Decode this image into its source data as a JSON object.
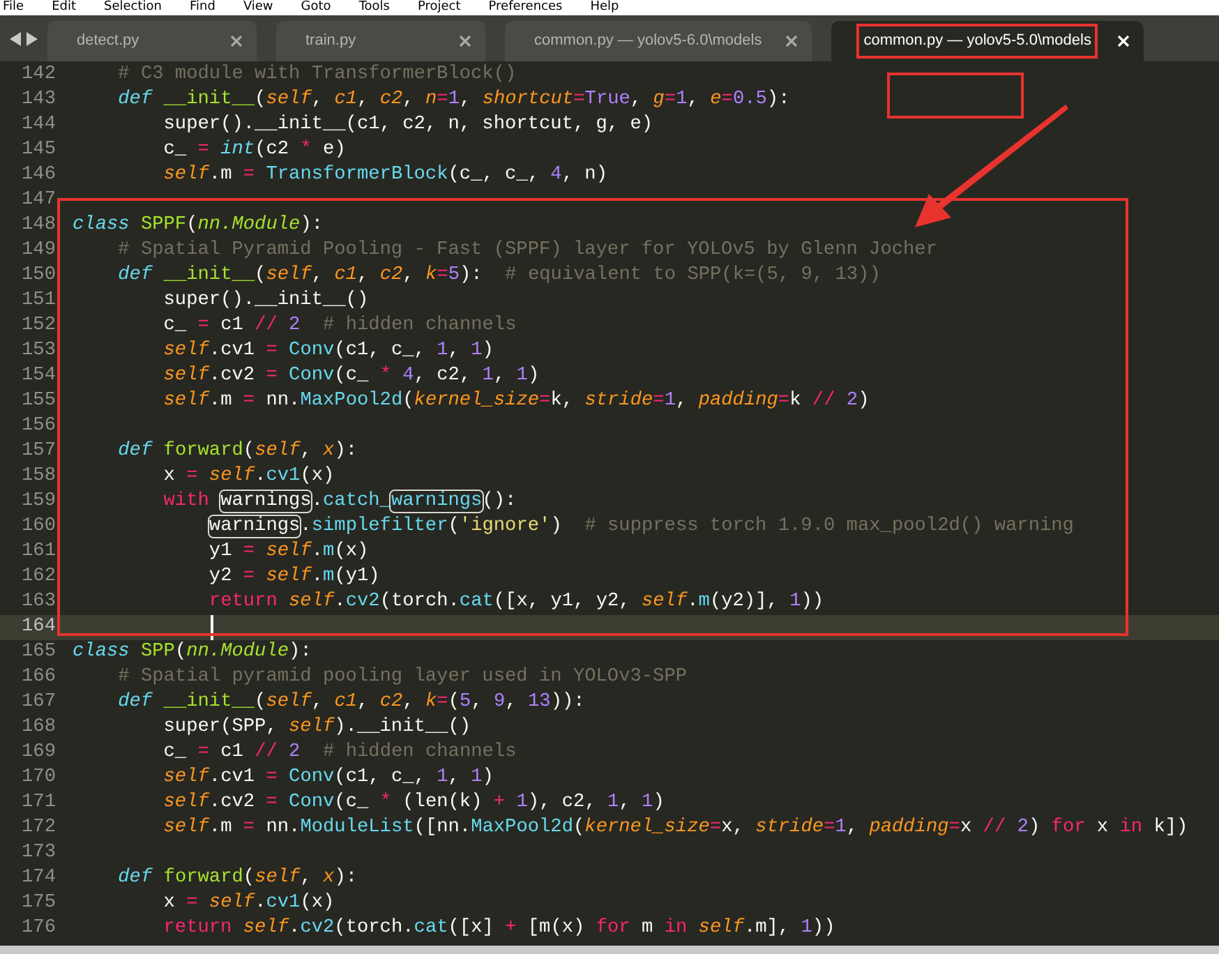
{
  "menu": [
    "File",
    "Edit",
    "Selection",
    "Find",
    "View",
    "Goto",
    "Tools",
    "Project",
    "Preferences",
    "Help"
  ],
  "tabs": [
    {
      "label": "detect.py",
      "selected": false,
      "marked": false
    },
    {
      "label": "train.py",
      "selected": false,
      "marked": false
    },
    {
      "label": "common.py — yolov5-6.0\\models",
      "selected": false,
      "marked": false
    },
    {
      "label": "common.py — yolov5-5.0\\models",
      "selected": true,
      "marked": true
    }
  ],
  "lines": [
    {
      "number": "142",
      "current": false,
      "tokens": [
        {
          "kind": "comment",
          "text": "    # C3 module with TransformerBlock()"
        }
      ]
    },
    {
      "number": "143",
      "current": false,
      "tokens": [
        {
          "kind": "storage",
          "text": "    def "
        },
        {
          "kind": "name",
          "text": "__init__"
        },
        {
          "kind": "plain",
          "text": "("
        },
        {
          "kind": "param",
          "text": "self"
        },
        {
          "kind": "plain",
          "text": ", "
        },
        {
          "kind": "param",
          "text": "c1"
        },
        {
          "kind": "plain",
          "text": ", "
        },
        {
          "kind": "param",
          "text": "c2"
        },
        {
          "kind": "plain",
          "text": ", "
        },
        {
          "kind": "param",
          "text": "n"
        },
        {
          "kind": "op",
          "text": "="
        },
        {
          "kind": "number",
          "text": "1"
        },
        {
          "kind": "plain",
          "text": ", "
        },
        {
          "kind": "param",
          "text": "shortcut"
        },
        {
          "kind": "op",
          "text": "="
        },
        {
          "kind": "number",
          "text": "True"
        },
        {
          "kind": "plain",
          "text": ", "
        },
        {
          "kind": "param",
          "text": "g"
        },
        {
          "kind": "op",
          "text": "="
        },
        {
          "kind": "number",
          "text": "1"
        },
        {
          "kind": "plain",
          "text": ", "
        },
        {
          "kind": "param",
          "text": "e"
        },
        {
          "kind": "op",
          "text": "="
        },
        {
          "kind": "number",
          "text": "0.5"
        },
        {
          "kind": "plain",
          "text": "):"
        }
      ]
    },
    {
      "number": "144",
      "current": false,
      "tokens": [
        {
          "kind": "plain",
          "text": "        super().__init__(c1, c2, n, shortcut, g, e)"
        }
      ]
    },
    {
      "number": "145",
      "current": false,
      "tokens": [
        {
          "kind": "plain",
          "text": "        c_ "
        },
        {
          "kind": "op",
          "text": "= "
        },
        {
          "kind": "storage",
          "text": "int"
        },
        {
          "kind": "plain",
          "text": "(c2 "
        },
        {
          "kind": "op",
          "text": "* "
        },
        {
          "kind": "plain",
          "text": "e)"
        }
      ]
    },
    {
      "number": "146",
      "current": false,
      "tokens": [
        {
          "kind": "self",
          "text": "        self"
        },
        {
          "kind": "plain",
          "text": ".m "
        },
        {
          "kind": "op",
          "text": "= "
        },
        {
          "kind": "support",
          "text": "TransformerBlock"
        },
        {
          "kind": "plain",
          "text": "(c_, c_, "
        },
        {
          "kind": "number",
          "text": "4"
        },
        {
          "kind": "plain",
          "text": ", n)"
        }
      ]
    },
    {
      "number": "147",
      "current": false
    },
    {
      "number": "148",
      "current": false,
      "tokens": [
        {
          "kind": "storage",
          "text": "class "
        },
        {
          "kind": "name",
          "text": "SPPF"
        },
        {
          "kind": "plain",
          "text": "("
        },
        {
          "kind": "inherit",
          "text": "nn.Module"
        },
        {
          "kind": "plain",
          "text": "):"
        }
      ]
    },
    {
      "number": "149",
      "current": false,
      "tokens": [
        {
          "kind": "comment",
          "text": "    # Spatial Pyramid Pooling - Fast (SPPF) layer for YOLOv5 by Glenn Jocher"
        }
      ]
    },
    {
      "number": "150",
      "current": false,
      "tokens": [
        {
          "kind": "storage",
          "text": "    def "
        },
        {
          "kind": "name",
          "text": "__init__"
        },
        {
          "kind": "plain",
          "text": "("
        },
        {
          "kind": "param",
          "text": "self"
        },
        {
          "kind": "plain",
          "text": ", "
        },
        {
          "kind": "param",
          "text": "c1"
        },
        {
          "kind": "plain",
          "text": ", "
        },
        {
          "kind": "param",
          "text": "c2"
        },
        {
          "kind": "plain",
          "text": ", "
        },
        {
          "kind": "param",
          "text": "k"
        },
        {
          "kind": "op",
          "text": "="
        },
        {
          "kind": "number",
          "text": "5"
        },
        {
          "kind": "plain",
          "text": "):"
        },
        {
          "kind": "comment",
          "text": "  # equivalent to SPP(k=(5, 9, 13))"
        }
      ]
    },
    {
      "number": "151",
      "current": false,
      "tokens": [
        {
          "kind": "plain",
          "text": "        super().__init__()"
        }
      ]
    },
    {
      "number": "152",
      "current": false,
      "tokens": [
        {
          "kind": "plain",
          "text": "        c_ "
        },
        {
          "kind": "op",
          "text": "= "
        },
        {
          "kind": "plain",
          "text": "c1 "
        },
        {
          "kind": "op",
          "text": "// "
        },
        {
          "kind": "number",
          "text": "2"
        },
        {
          "kind": "comment",
          "text": "  # hidden channels"
        }
      ]
    },
    {
      "number": "153",
      "current": false,
      "tokens": [
        {
          "kind": "self",
          "text": "        self"
        },
        {
          "kind": "plain",
          "text": ".cv1 "
        },
        {
          "kind": "op",
          "text": "= "
        },
        {
          "kind": "support",
          "text": "Conv"
        },
        {
          "kind": "plain",
          "text": "(c1, c_, "
        },
        {
          "kind": "number",
          "text": "1"
        },
        {
          "kind": "plain",
          "text": ", "
        },
        {
          "kind": "number",
          "text": "1"
        },
        {
          "kind": "plain",
          "text": ")"
        }
      ]
    },
    {
      "number": "154",
      "current": false,
      "tokens": [
        {
          "kind": "self",
          "text": "        self"
        },
        {
          "kind": "plain",
          "text": ".cv2 "
        },
        {
          "kind": "op",
          "text": "= "
        },
        {
          "kind": "support",
          "text": "Conv"
        },
        {
          "kind": "plain",
          "text": "(c_ "
        },
        {
          "kind": "op",
          "text": "* "
        },
        {
          "kind": "number",
          "text": "4"
        },
        {
          "kind": "plain",
          "text": ", c2, "
        },
        {
          "kind": "number",
          "text": "1"
        },
        {
          "kind": "plain",
          "text": ", "
        },
        {
          "kind": "number",
          "text": "1"
        },
        {
          "kind": "plain",
          "text": ")"
        }
      ]
    },
    {
      "number": "155",
      "current": false,
      "tokens": [
        {
          "kind": "self",
          "text": "        self"
        },
        {
          "kind": "plain",
          "text": ".m "
        },
        {
          "kind": "op",
          "text": "= "
        },
        {
          "kind": "plain",
          "text": "nn."
        },
        {
          "kind": "support",
          "text": "MaxPool2d"
        },
        {
          "kind": "plain",
          "text": "("
        },
        {
          "kind": "param",
          "text": "kernel_size"
        },
        {
          "kind": "op",
          "text": "="
        },
        {
          "kind": "plain",
          "text": "k, "
        },
        {
          "kind": "param",
          "text": "stride"
        },
        {
          "kind": "op",
          "text": "="
        },
        {
          "kind": "number",
          "text": "1"
        },
        {
          "kind": "plain",
          "text": ", "
        },
        {
          "kind": "param",
          "text": "padding"
        },
        {
          "kind": "op",
          "text": "="
        },
        {
          "kind": "plain",
          "text": "k "
        },
        {
          "kind": "op",
          "text": "// "
        },
        {
          "kind": "number",
          "text": "2"
        },
        {
          "kind": "plain",
          "text": ")"
        }
      ]
    },
    {
      "number": "156",
      "current": false
    },
    {
      "number": "157",
      "current": false,
      "tokens": [
        {
          "kind": "storage",
          "text": "    def "
        },
        {
          "kind": "name",
          "text": "forward"
        },
        {
          "kind": "plain",
          "text": "("
        },
        {
          "kind": "param",
          "text": "self"
        },
        {
          "kind": "plain",
          "text": ", "
        },
        {
          "kind": "param",
          "text": "x"
        },
        {
          "kind": "plain",
          "text": "):"
        }
      ]
    },
    {
      "number": "158",
      "current": false,
      "tokens": [
        {
          "kind": "plain",
          "text": "        x "
        },
        {
          "kind": "op",
          "text": "= "
        },
        {
          "kind": "self",
          "text": "self"
        },
        {
          "kind": "plain",
          "text": "."
        },
        {
          "kind": "support",
          "text": "cv1"
        },
        {
          "kind": "plain",
          "text": "(x)"
        }
      ]
    },
    {
      "number": "159",
      "current": false,
      "tokens": [
        {
          "kind": "keyword",
          "text": "        with "
        },
        {
          "kind": "match",
          "text": "warnings"
        },
        {
          "kind": "plain",
          "text": "."
        },
        {
          "kind": "support",
          "text": "catch_"
        },
        {
          "kind": "matchcall",
          "text": "warnings"
        },
        {
          "kind": "plain",
          "text": "():"
        }
      ]
    },
    {
      "number": "160",
      "current": false,
      "tokens": [
        {
          "kind": "match",
          "text": "            warnings"
        },
        {
          "kind": "plain",
          "text": "."
        },
        {
          "kind": "support",
          "text": "simplefilter"
        },
        {
          "kind": "plain",
          "text": "("
        },
        {
          "kind": "string",
          "text": "'ignore'"
        },
        {
          "kind": "plain",
          "text": ")"
        },
        {
          "kind": "comment",
          "text": "  # suppress torch 1.9.0 max_pool2d() warning"
        }
      ]
    },
    {
      "number": "161",
      "current": false,
      "tokens": [
        {
          "kind": "plain",
          "text": "            y1 "
        },
        {
          "kind": "op",
          "text": "= "
        },
        {
          "kind": "self",
          "text": "self"
        },
        {
          "kind": "plain",
          "text": "."
        },
        {
          "kind": "support",
          "text": "m"
        },
        {
          "kind": "plain",
          "text": "(x)"
        }
      ]
    },
    {
      "number": "162",
      "current": false,
      "tokens": [
        {
          "kind": "plain",
          "text": "            y2 "
        },
        {
          "kind": "op",
          "text": "= "
        },
        {
          "kind": "self",
          "text": "self"
        },
        {
          "kind": "plain",
          "text": "."
        },
        {
          "kind": "support",
          "text": "m"
        },
        {
          "kind": "plain",
          "text": "(y1)"
        }
      ]
    },
    {
      "number": "163",
      "current": false,
      "tokens": [
        {
          "kind": "keyword",
          "text": "            return "
        },
        {
          "kind": "self",
          "text": "self"
        },
        {
          "kind": "plain",
          "text": "."
        },
        {
          "kind": "support",
          "text": "cv2"
        },
        {
          "kind": "plain",
          "text": "(torch."
        },
        {
          "kind": "support",
          "text": "cat"
        },
        {
          "kind": "plain",
          "text": "([x, y1, y2, "
        },
        {
          "kind": "self",
          "text": "self"
        },
        {
          "kind": "plain",
          "text": "."
        },
        {
          "kind": "support",
          "text": "m"
        },
        {
          "kind": "plain",
          "text": "(y2)], "
        },
        {
          "kind": "number",
          "text": "1"
        },
        {
          "kind": "plain",
          "text": "))"
        }
      ]
    },
    {
      "number": "164",
      "current": true
    },
    {
      "number": "165",
      "current": false,
      "tokens": [
        {
          "kind": "storage",
          "text": "class "
        },
        {
          "kind": "name",
          "text": "SPP"
        },
        {
          "kind": "plain",
          "text": "("
        },
        {
          "kind": "inherit",
          "text": "nn.Module"
        },
        {
          "kind": "plain",
          "text": "):"
        }
      ]
    },
    {
      "number": "166",
      "current": false,
      "tokens": [
        {
          "kind": "comment",
          "text": "    # Spatial pyramid pooling layer used in YOLOv3-SPP"
        }
      ]
    },
    {
      "number": "167",
      "current": false,
      "tokens": [
        {
          "kind": "storage",
          "text": "    def "
        },
        {
          "kind": "name",
          "text": "__init__"
        },
        {
          "kind": "plain",
          "text": "("
        },
        {
          "kind": "param",
          "text": "self"
        },
        {
          "kind": "plain",
          "text": ", "
        },
        {
          "kind": "param",
          "text": "c1"
        },
        {
          "kind": "plain",
          "text": ", "
        },
        {
          "kind": "param",
          "text": "c2"
        },
        {
          "kind": "plain",
          "text": ", "
        },
        {
          "kind": "param",
          "text": "k"
        },
        {
          "kind": "op",
          "text": "="
        },
        {
          "kind": "plain",
          "text": "("
        },
        {
          "kind": "number",
          "text": "5"
        },
        {
          "kind": "plain",
          "text": ", "
        },
        {
          "kind": "number",
          "text": "9"
        },
        {
          "kind": "plain",
          "text": ", "
        },
        {
          "kind": "number",
          "text": "13"
        },
        {
          "kind": "plain",
          "text": ")):"
        }
      ]
    },
    {
      "number": "168",
      "current": false,
      "tokens": [
        {
          "kind": "plain",
          "text": "        super(SPP, "
        },
        {
          "kind": "self",
          "text": "self"
        },
        {
          "kind": "plain",
          "text": ").__init__()"
        }
      ]
    },
    {
      "number": "169",
      "current": false,
      "tokens": [
        {
          "kind": "plain",
          "text": "        c_ "
        },
        {
          "kind": "op",
          "text": "= "
        },
        {
          "kind": "plain",
          "text": "c1 "
        },
        {
          "kind": "op",
          "text": "// "
        },
        {
          "kind": "number",
          "text": "2"
        },
        {
          "kind": "comment",
          "text": "  # hidden channels"
        }
      ]
    },
    {
      "number": "170",
      "current": false,
      "tokens": [
        {
          "kind": "self",
          "text": "        self"
        },
        {
          "kind": "plain",
          "text": ".cv1 "
        },
        {
          "kind": "op",
          "text": "= "
        },
        {
          "kind": "support",
          "text": "Conv"
        },
        {
          "kind": "plain",
          "text": "(c1, c_, "
        },
        {
          "kind": "number",
          "text": "1"
        },
        {
          "kind": "plain",
          "text": ", "
        },
        {
          "kind": "number",
          "text": "1"
        },
        {
          "kind": "plain",
          "text": ")"
        }
      ]
    },
    {
      "number": "171",
      "current": false,
      "tokens": [
        {
          "kind": "self",
          "text": "        self"
        },
        {
          "kind": "plain",
          "text": ".cv2 "
        },
        {
          "kind": "op",
          "text": "= "
        },
        {
          "kind": "support",
          "text": "Conv"
        },
        {
          "kind": "plain",
          "text": "(c_ "
        },
        {
          "kind": "op",
          "text": "* "
        },
        {
          "kind": "plain",
          "text": "(len(k) "
        },
        {
          "kind": "op",
          "text": "+ "
        },
        {
          "kind": "number",
          "text": "1"
        },
        {
          "kind": "plain",
          "text": "), c2, "
        },
        {
          "kind": "number",
          "text": "1"
        },
        {
          "kind": "plain",
          "text": ", "
        },
        {
          "kind": "number",
          "text": "1"
        },
        {
          "kind": "plain",
          "text": ")"
        }
      ]
    },
    {
      "number": "172",
      "current": false,
      "tokens": [
        {
          "kind": "self",
          "text": "        self"
        },
        {
          "kind": "plain",
          "text": ".m "
        },
        {
          "kind": "op",
          "text": "= "
        },
        {
          "kind": "plain",
          "text": "nn."
        },
        {
          "kind": "support",
          "text": "ModuleList"
        },
        {
          "kind": "plain",
          "text": "([nn."
        },
        {
          "kind": "support",
          "text": "MaxPool2d"
        },
        {
          "kind": "plain",
          "text": "("
        },
        {
          "kind": "param",
          "text": "kernel_size"
        },
        {
          "kind": "op",
          "text": "="
        },
        {
          "kind": "plain",
          "text": "x, "
        },
        {
          "kind": "param",
          "text": "stride"
        },
        {
          "kind": "op",
          "text": "="
        },
        {
          "kind": "number",
          "text": "1"
        },
        {
          "kind": "plain",
          "text": ", "
        },
        {
          "kind": "param",
          "text": "padding"
        },
        {
          "kind": "op",
          "text": "="
        },
        {
          "kind": "plain",
          "text": "x "
        },
        {
          "kind": "op",
          "text": "// "
        },
        {
          "kind": "number",
          "text": "2"
        },
        {
          "kind": "plain",
          "text": ") "
        },
        {
          "kind": "keyword",
          "text": "for "
        },
        {
          "kind": "plain",
          "text": "x "
        },
        {
          "kind": "keyword",
          "text": "in "
        },
        {
          "kind": "plain",
          "text": "k])"
        }
      ]
    },
    {
      "number": "173",
      "current": false
    },
    {
      "number": "174",
      "current": false,
      "tokens": [
        {
          "kind": "storage",
          "text": "    def "
        },
        {
          "kind": "name",
          "text": "forward"
        },
        {
          "kind": "plain",
          "text": "("
        },
        {
          "kind": "param",
          "text": "self"
        },
        {
          "kind": "plain",
          "text": ", "
        },
        {
          "kind": "param",
          "text": "x"
        },
        {
          "kind": "plain",
          "text": "):"
        }
      ]
    },
    {
      "number": "175",
      "current": false,
      "tokens": [
        {
          "kind": "plain",
          "text": "        x "
        },
        {
          "kind": "op",
          "text": "= "
        },
        {
          "kind": "self",
          "text": "self"
        },
        {
          "kind": "plain",
          "text": "."
        },
        {
          "kind": "support",
          "text": "cv1"
        },
        {
          "kind": "plain",
          "text": "(x)"
        }
      ]
    },
    {
      "number": "176",
      "current": false,
      "tokens": [
        {
          "kind": "keyword",
          "text": "        return "
        },
        {
          "kind": "self",
          "text": "self"
        },
        {
          "kind": "plain",
          "text": "."
        },
        {
          "kind": "support",
          "text": "cv2"
        },
        {
          "kind": "plain",
          "text": "(torch."
        },
        {
          "kind": "support",
          "text": "cat"
        },
        {
          "kind": "plain",
          "text": "([x] "
        },
        {
          "kind": "op",
          "text": "+ "
        },
        {
          "kind": "plain",
          "text": "[m(x) "
        },
        {
          "kind": "keyword",
          "text": "for "
        },
        {
          "kind": "plain",
          "text": "m "
        },
        {
          "kind": "keyword",
          "text": "in "
        },
        {
          "kind": "self",
          "text": "self"
        },
        {
          "kind": "plain",
          "text": ".m], "
        },
        {
          "kind": "number",
          "text": "1"
        },
        {
          "kind": "plain",
          "text": "))"
        }
      ]
    }
  ],
  "annotations": [
    {
      "kind": "box"
    },
    {
      "kind": "box"
    },
    {
      "kind": "arrow"
    }
  ]
}
